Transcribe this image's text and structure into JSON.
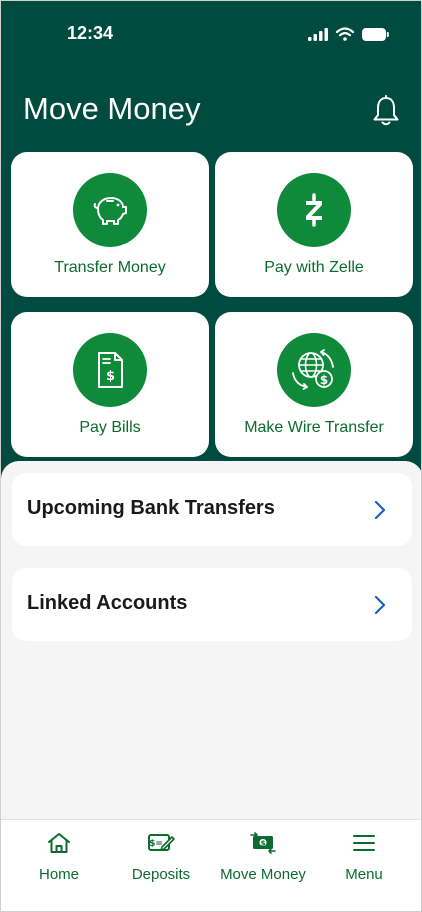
{
  "status_bar": {
    "time": "12:34"
  },
  "header": {
    "title": "Move Money"
  },
  "actions": [
    {
      "label": "Transfer Money",
      "icon": "piggy-bank-icon"
    },
    {
      "label": "Pay with Zelle",
      "icon": "zelle-icon"
    },
    {
      "label": "Pay Bills",
      "icon": "bill-icon"
    },
    {
      "label": "Make Wire Transfer",
      "icon": "globe-dollar-icon"
    }
  ],
  "list": [
    {
      "label": "Upcoming Bank Transfers"
    },
    {
      "label": "Linked Accounts"
    }
  ],
  "tabs": [
    {
      "label": "Home",
      "icon": "home-icon"
    },
    {
      "label": "Deposits",
      "icon": "check-deposit-icon"
    },
    {
      "label": "Move Money",
      "icon": "money-transfer-icon",
      "active": true
    },
    {
      "label": "Menu",
      "icon": "hamburger-menu-icon"
    }
  ],
  "colors": {
    "header": "#004b40",
    "accent": "#0f8a3a",
    "label": "#0c6b2e",
    "chevron": "#1f5fc2"
  }
}
